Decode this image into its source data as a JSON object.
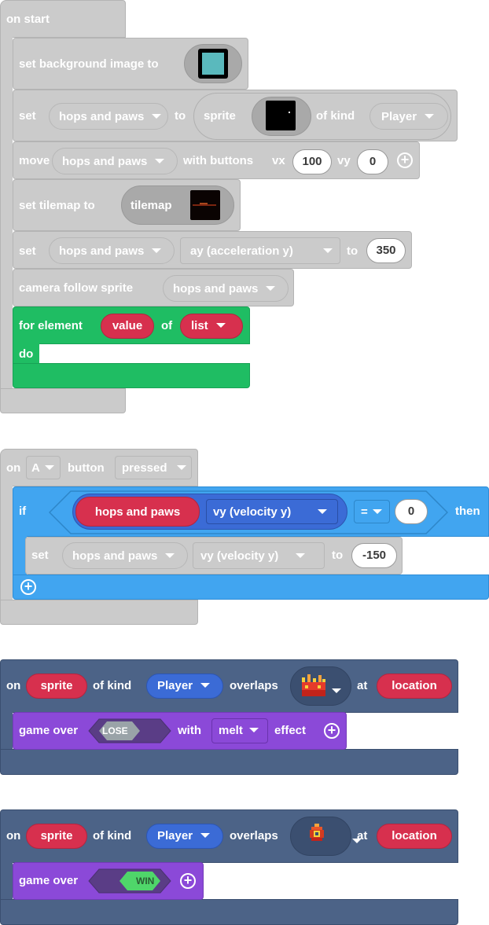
{
  "colors": {
    "gray_block": "#cbcbcb",
    "green_loop": "#1fbd63",
    "blue_logic": "#41a5f0",
    "dark_event": "#4c6387",
    "purple_game": "#8b49d8",
    "red_pill": "#d7304e",
    "blue_pill": "#3b6bd6"
  },
  "on_start": {
    "hat": "on start",
    "set_bg": {
      "label": "set background image to",
      "image_icon": "teal-square-image-icon"
    },
    "set_sprite": {
      "set": "set",
      "var": "hops and paws",
      "to": "to",
      "sprite": "sprite",
      "of_kind": "of kind",
      "kind": "Player",
      "image_icon": "black-sprite-image-icon"
    },
    "move": {
      "label": "move",
      "var": "hops and paws",
      "with_buttons": "with buttons",
      "vx_label": "vx",
      "vx": "100",
      "vy_label": "vy",
      "vy": "0"
    },
    "tilemap": {
      "label": "set tilemap to",
      "inner": "tilemap",
      "image_icon": "tilemap-image-icon"
    },
    "set_accel": {
      "set": "set",
      "var": "hops and paws",
      "prop": "ay (acceleration y)",
      "to": "to",
      "value": "350"
    },
    "camera": {
      "label": "camera follow sprite",
      "var": "hops and paws"
    },
    "for_loop": {
      "label": "for element",
      "elem": "value",
      "of": "of",
      "list": "list",
      "do": "do"
    }
  },
  "on_button": {
    "on": "on",
    "button": "A",
    "button_label": "button",
    "event": "pressed",
    "if_block": {
      "if": "if",
      "var": "hops and paws",
      "prop": "vy (velocity y)",
      "op": "=",
      "value": "0",
      "then": "then"
    },
    "set_block": {
      "set": "set",
      "var": "hops and paws",
      "prop": "vy (velocity y)",
      "to": "to",
      "value": "-150"
    }
  },
  "overlap_lose": {
    "on": "on",
    "sprite": "sprite",
    "of_kind": "of kind",
    "kind": "Player",
    "overlaps": "overlaps",
    "tile_icon": "crown-fire-tile-icon",
    "at": "at",
    "location": "location",
    "game_over": {
      "label": "game over",
      "result": "LOSE",
      "with": "with",
      "effect_value": "melt",
      "effect": "effect"
    }
  },
  "overlap_win": {
    "on": "on",
    "sprite": "sprite",
    "of_kind": "of kind",
    "kind": "Player",
    "overlaps": "overlaps",
    "tile_icon": "fire-gem-tile-icon",
    "at": "at",
    "location": "location",
    "game_over": {
      "label": "game over",
      "result": "WIN"
    }
  }
}
